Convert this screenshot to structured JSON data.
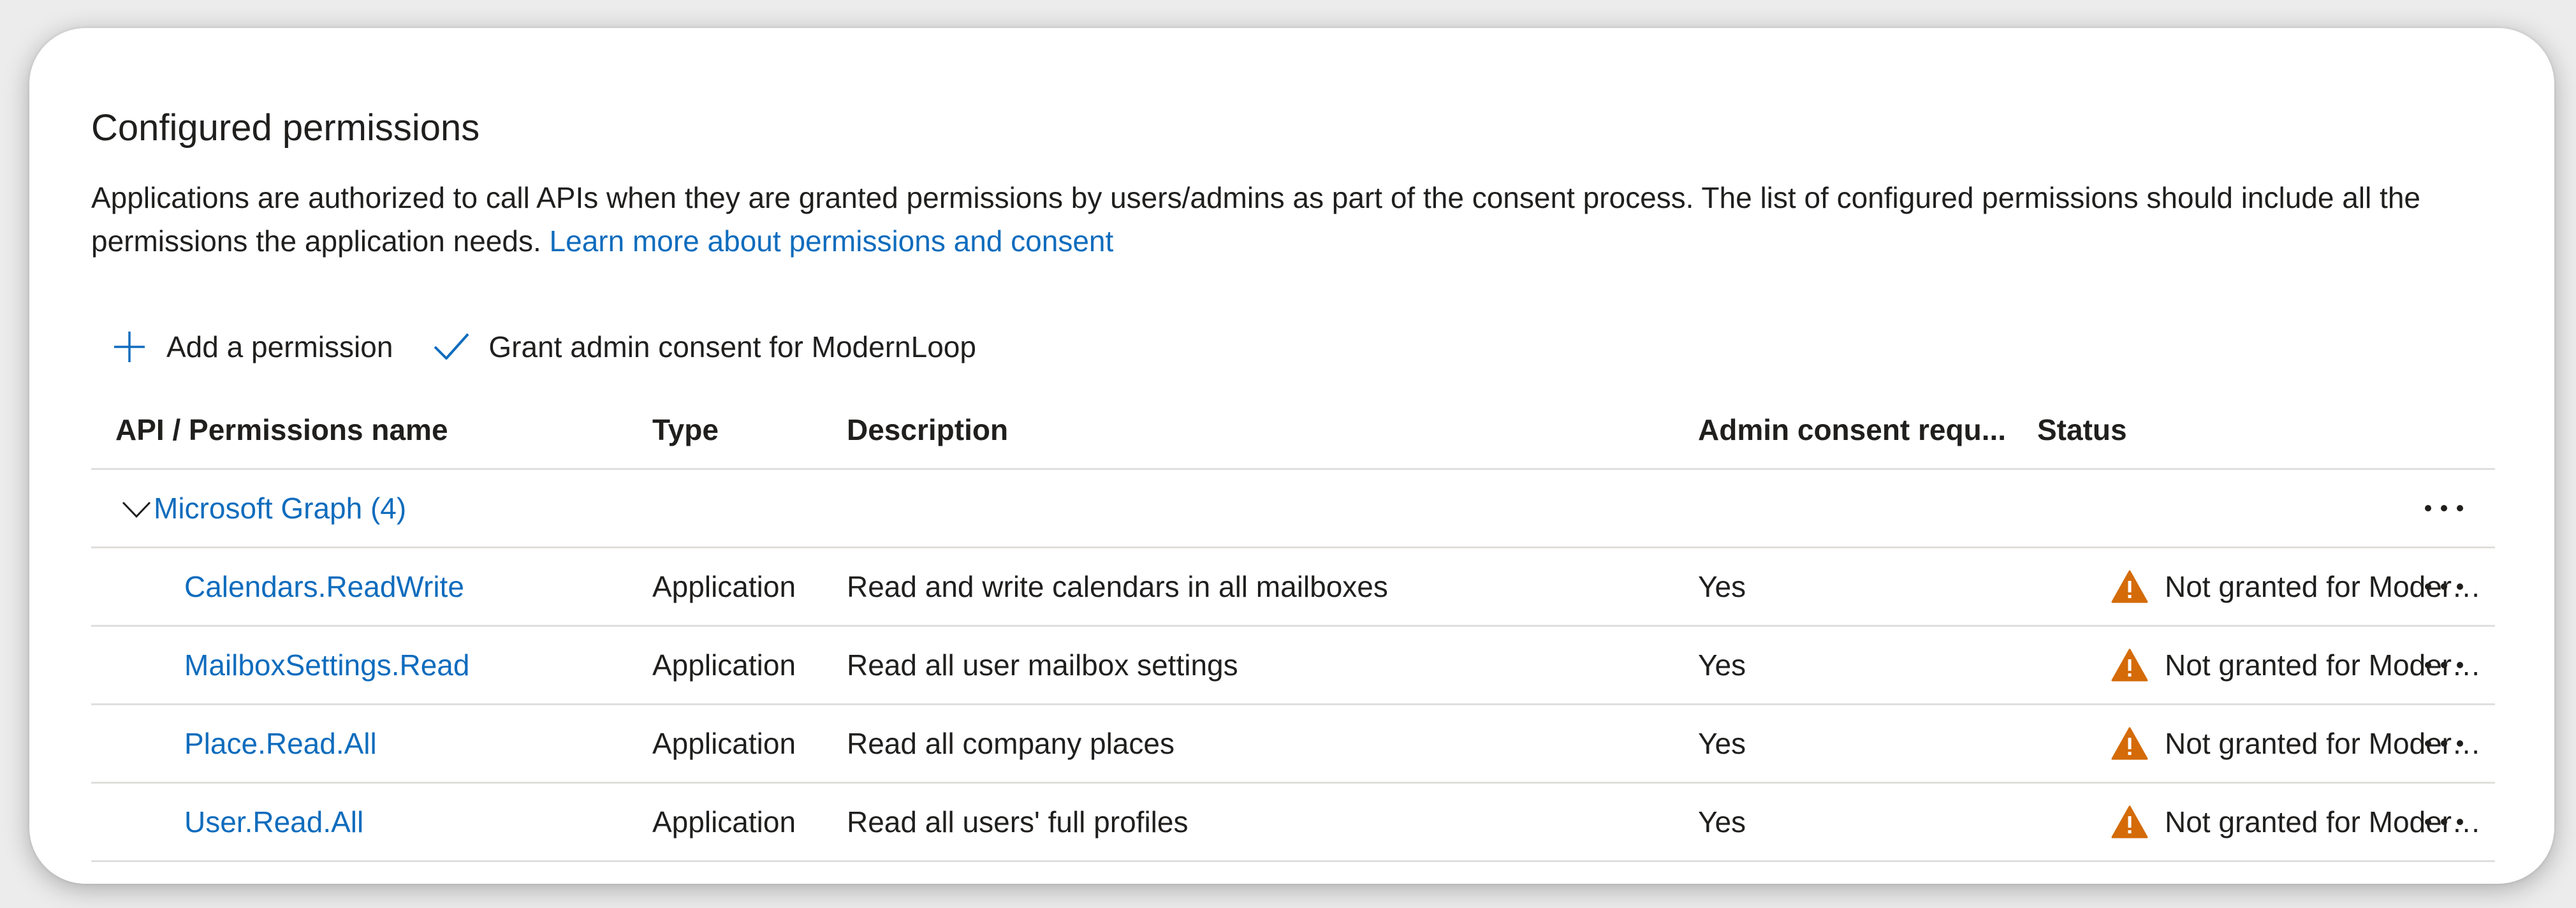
{
  "section": {
    "title": "Configured permissions",
    "description": "Applications are authorized to call APIs when they are granted permissions by users/admins as part of the consent process. The list of configured permissions should include all the permissions the application needs.",
    "learn_more_link": "Learn more about permissions and consent"
  },
  "toolbar": {
    "add_permission_label": "Add a permission",
    "grant_consent_label": "Grant admin consent for ModernLoop",
    "add_icon": "plus-icon",
    "grant_icon": "checkmark-icon"
  },
  "table": {
    "columns": [
      "API / Permissions name",
      "Type",
      "Description",
      "Admin consent requ...",
      "Status"
    ],
    "group": {
      "name": "Microsoft Graph (4)",
      "expanded": true
    },
    "rows": [
      {
        "name": "Calendars.ReadWrite",
        "type": "Application",
        "description": "Read and write calendars in all mailboxes",
        "admin_consent": "Yes",
        "status": "Not granted for ModernLoop"
      },
      {
        "name": "MailboxSettings.Read",
        "type": "Application",
        "description": "Read all user mailbox settings",
        "admin_consent": "Yes",
        "status": "Not granted for ModernLoop"
      },
      {
        "name": "Place.Read.All",
        "type": "Application",
        "description": "Read all company places",
        "admin_consent": "Yes",
        "status": "Not granted for ModernLoop"
      },
      {
        "name": "User.Read.All",
        "type": "Application",
        "description": "Read all users' full profiles",
        "admin_consent": "Yes",
        "status": "Not granted for ModernLoop"
      }
    ]
  },
  "colors": {
    "link": "#0f6cbd",
    "warning": "#d46b08",
    "text": "#201f1e",
    "divider": "#e1dfdd"
  }
}
